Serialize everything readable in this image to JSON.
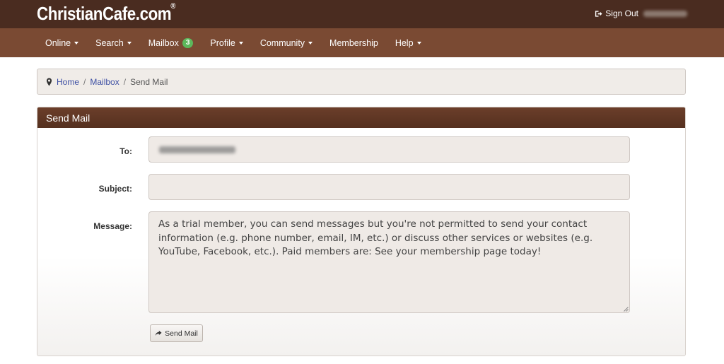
{
  "header": {
    "logo": "ChristianCafe.com",
    "logo_mark": "®",
    "signout_label": "Sign Out",
    "signout_icon": "sign-out-icon"
  },
  "nav": {
    "items": [
      {
        "label": "Online",
        "dropdown": true
      },
      {
        "label": "Search",
        "dropdown": true
      },
      {
        "label": "Mailbox",
        "badge": "3"
      },
      {
        "label": "Profile",
        "dropdown": true
      },
      {
        "label": "Community",
        "dropdown": true
      },
      {
        "label": "Membership"
      },
      {
        "label": "Help",
        "dropdown": true
      }
    ]
  },
  "breadcrumb": {
    "icon": "map-marker-icon",
    "home": "Home",
    "sep": "/",
    "mailbox": "Mailbox",
    "current": "Send Mail"
  },
  "form": {
    "title": "Send Mail",
    "to_label": "To:",
    "subject_label": "Subject:",
    "subject_value": "",
    "message_label": "Message:",
    "message_value": "As a trial member, you can send messages but you're not permitted to send your contact information (e.g. phone number, email, IM, etc.) or discuss other services or websites (e.g. YouTube, Facebook, etc.). Paid members are: See your membership page today!",
    "send_label": "Send Mail",
    "send_icon": "share-icon"
  },
  "colors": {
    "header_bg": "#4a2c20",
    "nav_bg": "#7a4a33",
    "badge": "#5cb85c",
    "link": "#3d4fa3"
  }
}
